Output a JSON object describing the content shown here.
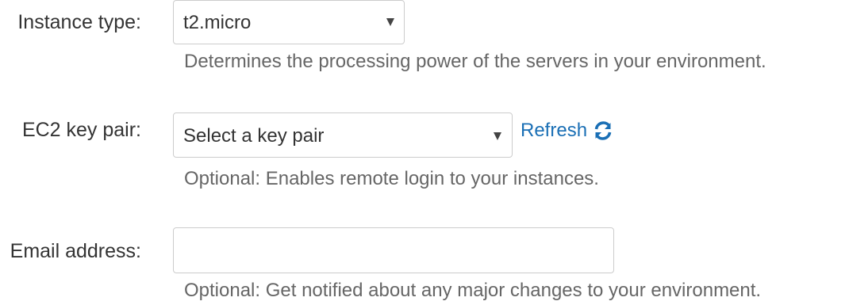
{
  "instance_type": {
    "label": "Instance type:",
    "selected": "t2.micro",
    "help": "Determines the processing power of the servers in your environment."
  },
  "key_pair": {
    "label": "EC2 key pair:",
    "selected": "Select a key pair",
    "refresh_label": "Refresh",
    "refresh_icon": "refresh-icon",
    "help": "Optional: Enables remote login to your instances."
  },
  "email": {
    "label": "Email address:",
    "value": "",
    "help": "Optional: Get notified about any major changes to your environment."
  },
  "colors": {
    "link": "#1a6fb5",
    "text": "#333333",
    "help_text": "#666666",
    "border": "#cccccc"
  }
}
